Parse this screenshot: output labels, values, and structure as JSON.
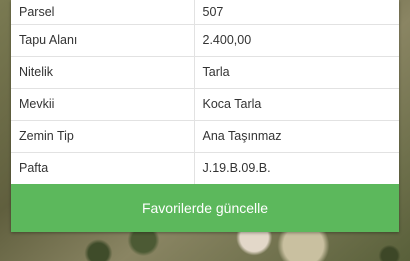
{
  "parcel_info": {
    "rows": [
      {
        "key": "Parsel",
        "value": "507"
      },
      {
        "key": "Tapu Alanı",
        "value": "2.400,00"
      },
      {
        "key": "Nitelik",
        "value": "Tarla"
      },
      {
        "key": "Mevkii",
        "value": "Koca Tarla"
      },
      {
        "key": "Zemin Tip",
        "value": "Ana Taşınmaz"
      },
      {
        "key": "Pafta",
        "value": "J.19.B.09.B."
      }
    ]
  },
  "actions": {
    "favorite_label": "Favorilerde güncelle"
  },
  "colors": {
    "button_green": "#5cb85c",
    "text": "#333333",
    "divider": "#e2e2e2"
  }
}
